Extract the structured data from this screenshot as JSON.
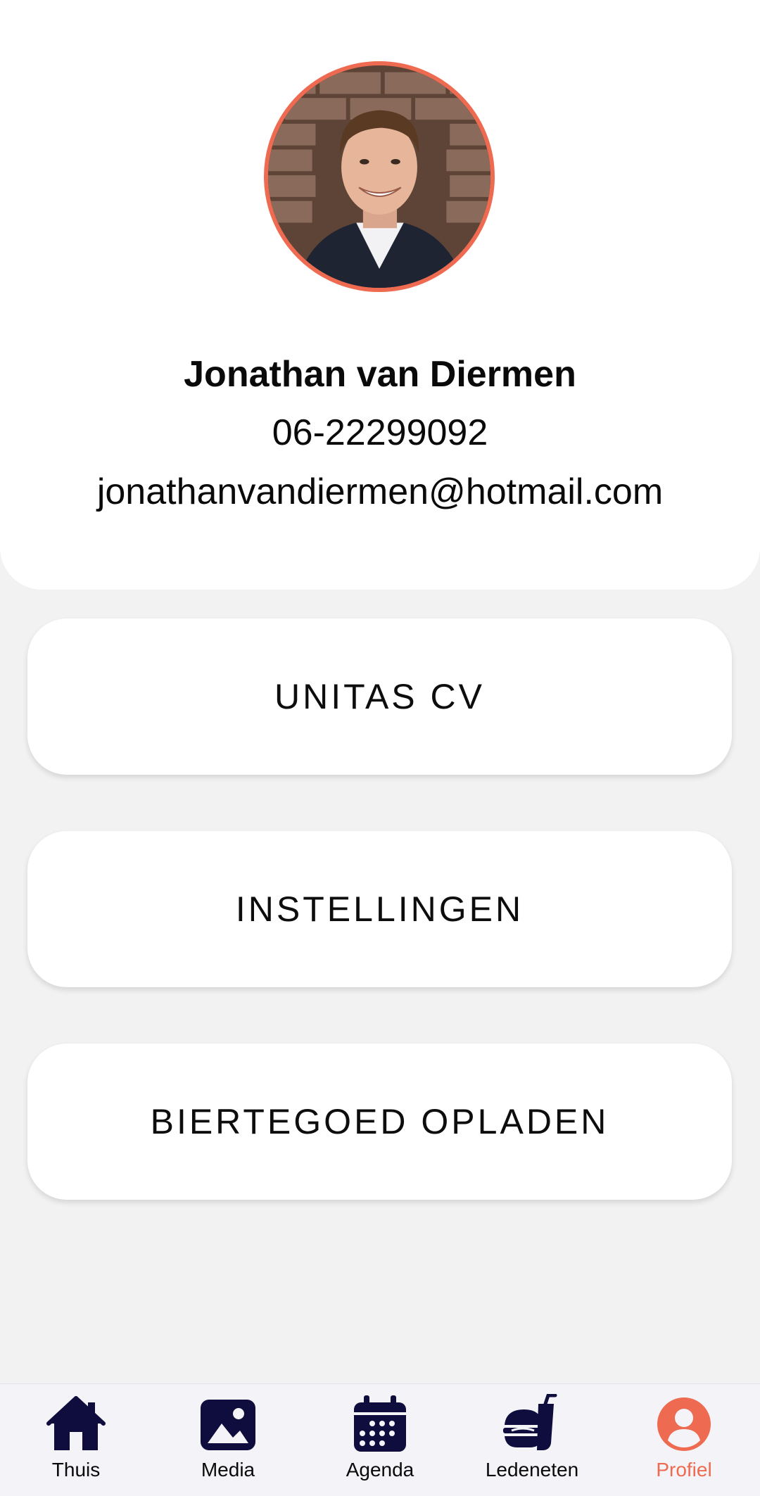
{
  "profile": {
    "name": "Jonathan van Diermen",
    "phone": "06-22299092",
    "email": "jonathanvandiermen@hotmail.com",
    "avatar_icon": "profile-photo",
    "avatar_border_color": "#ee6a50"
  },
  "actions": [
    {
      "label": "UNITAS CV"
    },
    {
      "label": "INSTELLINGEN"
    },
    {
      "label": "BIERTEGOED OPLADEN"
    }
  ],
  "nav": {
    "items": [
      {
        "label": "Thuis",
        "icon": "home-icon"
      },
      {
        "label": "Media",
        "icon": "image-icon"
      },
      {
        "label": "Agenda",
        "icon": "calendar-icon"
      },
      {
        "label": "Ledeneten",
        "icon": "food-icon"
      },
      {
        "label": "Profiel",
        "icon": "user-icon",
        "active": true
      }
    ],
    "icon_color": "#0f0d3d",
    "active_color": "#ee6a50"
  }
}
